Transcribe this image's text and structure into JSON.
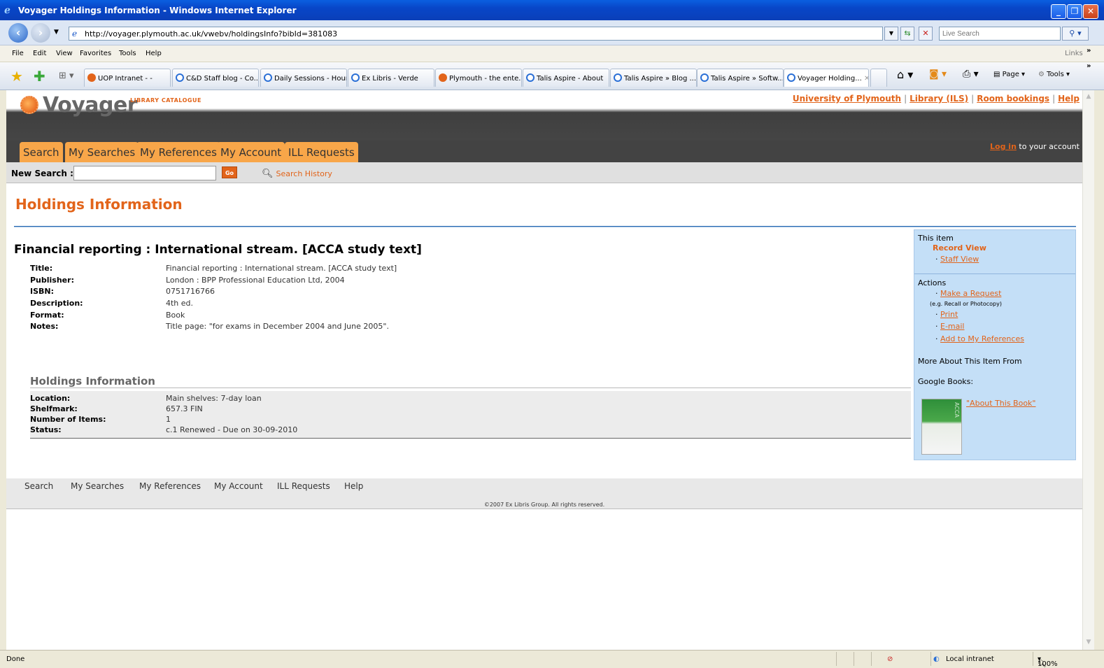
{
  "window": {
    "title": "Voyager Holdings Information - Windows Internet Explorer",
    "minimize": "_",
    "maximize": "❐",
    "close": "✕"
  },
  "address": {
    "url": "http://voyager.plymouth.ac.uk/vwebv/holdingsInfo?bibId=381083",
    "search_placeholder": "Live Search"
  },
  "menu": [
    "File",
    "Edit",
    "View",
    "Favorites",
    "Tools",
    "Help"
  ],
  "menu_links": "Links",
  "tabs": [
    {
      "label": "UOP Intranet - -",
      "icon": "voyager-icon"
    },
    {
      "label": "C&D Staff blog - Co...",
      "icon": "ie-icon"
    },
    {
      "label": "Daily Sessions - Hourly",
      "icon": "ie-icon"
    },
    {
      "label": "Ex Libris - Verde",
      "icon": "ie-icon"
    },
    {
      "label": "Plymouth - the ente...",
      "icon": "voyager-icon"
    },
    {
      "label": "Talis Aspire - About",
      "icon": "ie-icon"
    },
    {
      "label": "Talis Aspire » Blog ...",
      "icon": "ie-icon"
    },
    {
      "label": "Talis Aspire » Softw...",
      "icon": "ie-icon"
    },
    {
      "label": "Voyager Holding...",
      "icon": "ie-icon"
    }
  ],
  "toolbar": {
    "page": "Page",
    "tools": "Tools"
  },
  "site": {
    "logo": "Voyager",
    "logo_sub": "LIBRARY CATALOGUE",
    "top_links": [
      "University of Plymouth",
      "Library (ILS)",
      "Room bookings",
      "Help"
    ],
    "nav_tabs": [
      "Search",
      "My Searches",
      "My References",
      "My Account",
      "ILL Requests"
    ],
    "login_link": "Log in",
    "login_text": " to your account",
    "new_search_label": "New Search :",
    "go": "Go",
    "search_history": "Search History"
  },
  "page": {
    "title": "Holdings Information",
    "record_title": "Financial reporting : International stream. [ACCA study text]",
    "fields": [
      {
        "label": "Title:",
        "value": "Financial reporting : International stream. [ACCA study text]"
      },
      {
        "label": "Publisher:",
        "value": "London : BPP Professional Education Ltd, 2004"
      },
      {
        "label": "ISBN:",
        "value": "0751716766"
      },
      {
        "label": "Description:",
        "value": "4th ed."
      },
      {
        "label": "Format:",
        "value": "Book"
      },
      {
        "label": "Notes:",
        "value": "Title page: \"for exams in December 2004 and June 2005\"."
      }
    ],
    "holdings_heading": "Holdings Information",
    "holdings": [
      {
        "label": "Location:",
        "value": "Main shelves: 7-day loan"
      },
      {
        "label": "Shelfmark:",
        "value": "657.3 FIN"
      },
      {
        "label": "Number of Items:",
        "value": "1"
      },
      {
        "label": "Status:",
        "value": "c.1 Renewed - Due on 30-09-2010"
      }
    ]
  },
  "sidebar": {
    "this_item": "This item",
    "record_view": "Record View",
    "staff_view": "Staff View",
    "actions": "Actions",
    "make_request": "Make a Request",
    "request_hint": "(e.g. Recall or Photocopy)",
    "print": "Print",
    "email": "E-mail",
    "add_refs": "Add to My References",
    "more_about": "More About This Item From",
    "google_books": "Google Books:",
    "about_book": "\"About This Book\"",
    "cover_text": "ACCA"
  },
  "footer": {
    "links": [
      "Search",
      "My Searches",
      "My References",
      "My Account",
      "ILL Requests",
      "Help"
    ],
    "copyright": "©2007 Ex Libris Group. All rights reserved."
  },
  "status": {
    "left": "Done",
    "zone": "Local intranet",
    "zoom": "100%"
  }
}
